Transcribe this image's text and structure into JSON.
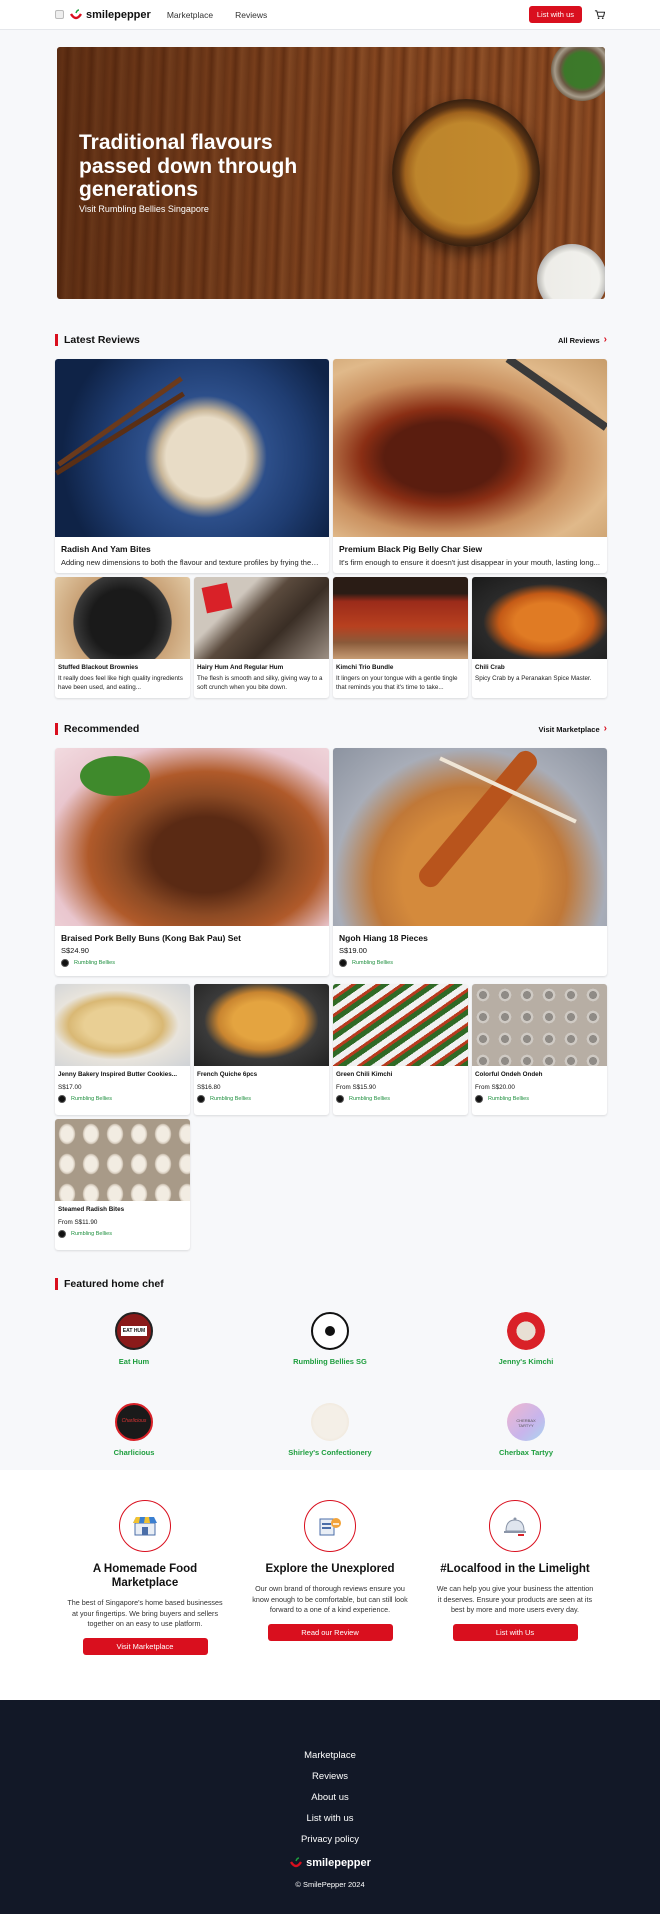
{
  "brand": {
    "name": "smilepepper",
    "accent": "#d90f1e",
    "green": "#1e9e3e"
  },
  "nav": {
    "links": [
      "Marketplace",
      "Reviews"
    ],
    "cta": "List with us",
    "icons": [
      "menu-icon",
      "cart-icon"
    ]
  },
  "hero": {
    "title": "Traditional flavours passed down through generations",
    "subtitle": "Visit Rumbling Bellies Singapore"
  },
  "reviews": {
    "heading": "Latest Reviews",
    "link": "All Reviews",
    "featured": [
      {
        "title": "Radish And Yam Bites",
        "desc": "Adding new dimensions to both the flavour and texture profiles by frying them..."
      },
      {
        "title": "Premium Black Pig Belly Char Siew",
        "desc": "It's firm enough to ensure it doesn't just disappear in your mouth, lasting long..."
      }
    ],
    "items": [
      {
        "title": "Stuffed Blackout Brownies",
        "desc": "It really does feel like high quality ingredients have been used, and eating..."
      },
      {
        "title": "Hairy Hum And Regular Hum",
        "desc": "The flesh is smooth and silky, giving way to a soft crunch when you bite down."
      },
      {
        "title": "Kimchi Trio Bundle",
        "desc": "It lingers on your tongue with a gentle tingle that reminds you that it's time to take..."
      },
      {
        "title": "Chili Crab",
        "desc": "Spicy Crab by a Peranakan Spice Master."
      }
    ]
  },
  "recommended": {
    "heading": "Recommended",
    "link": "Visit Marketplace",
    "featured": [
      {
        "title": "Braised Pork Belly Buns (Kong Bak Pau) Set",
        "price": "S$24.90",
        "seller": "Rumbling Bellies"
      },
      {
        "title": "Ngoh Hiang 18 Pieces",
        "price": "S$19.00",
        "seller": "Rumbling Bellies"
      }
    ],
    "items": [
      {
        "title": "Jenny Bakery Inspired Butter Cookies...",
        "price": "S$17.00",
        "seller": "Rumbling Bellies"
      },
      {
        "title": "French Quiche 6pcs",
        "price": "S$16.80",
        "seller": "Rumbling Bellies"
      },
      {
        "title": "Green Chili Kimchi",
        "price": "From S$15.90",
        "seller": "Rumbling Bellies"
      },
      {
        "title": "Colorful Ondeh Ondeh",
        "price": "From S$20.00",
        "seller": "Rumbling Bellies"
      },
      {
        "title": "Steamed Radish Bites",
        "price": "From S$11.90",
        "seller": "Rumbling Bellies"
      }
    ]
  },
  "chefs": {
    "heading": "Featured home chef",
    "list": [
      {
        "name": "Eat Hum",
        "logo_text": "EAT HUM"
      },
      {
        "name": "Rumbling Bellies SG",
        "logo_text": ""
      },
      {
        "name": "Jenny's Kimchi",
        "logo_text": ""
      },
      {
        "name": "Charlicious",
        "logo_text": "Charlicious"
      },
      {
        "name": "Shirley's Confectionery",
        "logo_text": ""
      },
      {
        "name": "Cherbax Tartyy",
        "logo_text": "CHERBAX TARTYY"
      }
    ]
  },
  "why": [
    {
      "title": "A Homemade Food Marketplace",
      "desc": "The best of Singapore's home based businesses at your fingertips. We bring buyers and sellers together on an easy to use platform.",
      "cta": "Visit Marketplace",
      "icon": "storefront-icon"
    },
    {
      "title": "Explore the Unexplored",
      "desc": "Our own brand of thorough reviews ensure you know enough to be comfortable, but can still look forward to a one of a kind experience.",
      "cta": "Read our Review",
      "icon": "thumbs-up-document-icon"
    },
    {
      "title": "#Localfood in the Limelight",
      "desc": "We can help you give your business the attention it deserves. Ensure your products are seen at its best by more and more users every day.",
      "cta": "List with Us",
      "icon": "serving-cloche-icon"
    }
  ],
  "footer": {
    "links": [
      "Marketplace",
      "Reviews",
      "About us",
      "List with us",
      "Privacy policy"
    ],
    "copyright": "© SmilePepper 2024"
  }
}
